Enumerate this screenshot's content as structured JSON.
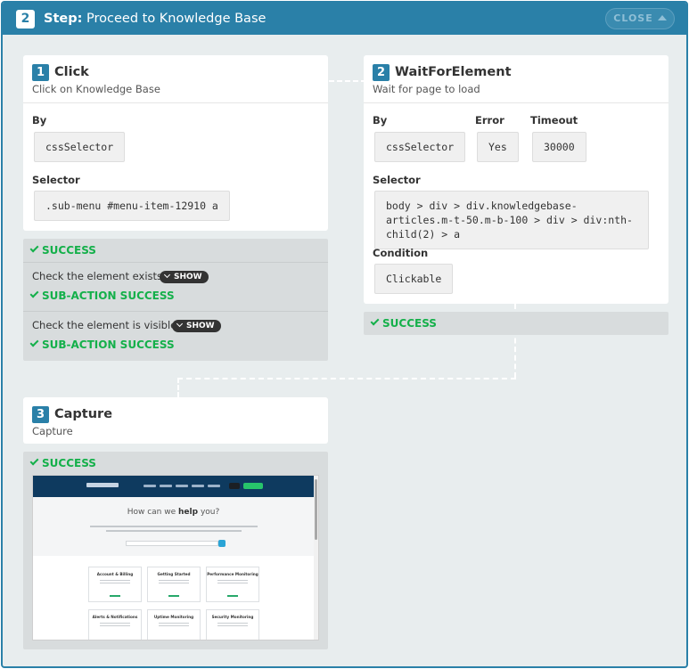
{
  "step": {
    "number": "2",
    "prefix": "Step:",
    "title": "Proceed to Knowledge Base",
    "close_label": "CLOSE"
  },
  "actions": [
    {
      "number": "1",
      "type": "Click",
      "description": "Click on Knowledge Base",
      "fields": {
        "by_label": "By",
        "by_value": "cssSelector",
        "selector_label": "Selector",
        "selector_value": ".sub-menu #menu-item-12910 a"
      },
      "result": {
        "status": "SUCCESS",
        "sub_actions": [
          {
            "text": "Check the element exists",
            "show_label": "SHOW",
            "status": "SUB-ACTION SUCCESS"
          },
          {
            "text": "Check the element is visible",
            "show_label": "SHOW",
            "status": "SUB-ACTION SUCCESS"
          }
        ]
      }
    },
    {
      "number": "2",
      "type": "WaitForElement",
      "description": "Wait for page to load",
      "fields": {
        "by_label": "By",
        "by_value": "cssSelector",
        "error_label": "Error",
        "error_value": "Yes",
        "timeout_label": "Timeout",
        "timeout_value": "30000",
        "selector_label": "Selector",
        "selector_value": "body > div > div.knowledgebase-articles.m-t-50.m-b-100 > div > div:nth-child(2) > a",
        "condition_label": "Condition",
        "condition_value": "Clickable"
      },
      "result": {
        "status": "SUCCESS"
      }
    },
    {
      "number": "3",
      "type": "Capture",
      "description": "Capture",
      "result": {
        "status": "SUCCESS",
        "screenshot": {
          "heading_prefix": "How can we",
          "heading_bold": "help",
          "heading_suffix": "you?",
          "tiles": [
            "Account & Billing",
            "Getting Started",
            "Performance Monitoring",
            "Alerts & Notifications",
            "Uptime Monitoring",
            "Security Monitoring"
          ]
        }
      }
    }
  ],
  "colors": {
    "accent": "#2a80a8",
    "success": "#14b04a",
    "panel": "#e8edee",
    "result_bg": "#d8dcdd"
  }
}
